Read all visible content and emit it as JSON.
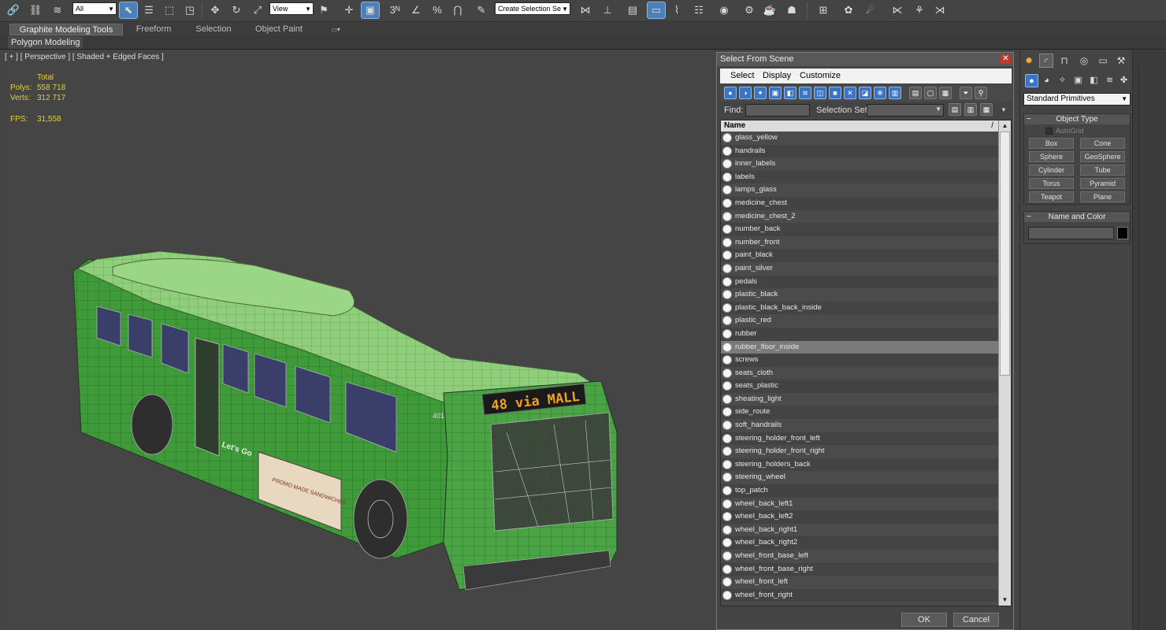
{
  "main_toolbar": {
    "selection_filter": "All",
    "reference_coord": "View",
    "named_selection_placeholder": "Create Selection Se",
    "snap_labels": [
      "3",
      "%"
    ]
  },
  "ribbon": {
    "tabs": [
      "Graphite Modeling Tools",
      "Freeform",
      "Selection",
      "Object Paint"
    ],
    "active_tab": 0,
    "panel_label": "Polygon Modeling"
  },
  "viewport": {
    "label": "[ + ] [ Perspective ] [ Shaded + Edged Faces ]",
    "stats_header": "Total",
    "stats": [
      {
        "key": "Polys:",
        "value": "558 718"
      },
      {
        "key": "Verts:",
        "value": "312 717"
      }
    ],
    "fps_key": "FPS:",
    "fps_value": "31,558",
    "bus": {
      "destination_sign": "48 via MALL",
      "unit_number": "401",
      "side_text": "Let's Go",
      "ad_text": "PROMO MADE SANDWICHES"
    }
  },
  "dialog": {
    "title": "Select From Scene",
    "menus": [
      "Select",
      "Display",
      "Customize"
    ],
    "find_label": "Find:",
    "find_value": "",
    "selection_set_label": "Selection Set:",
    "column_header": "Name",
    "items": [
      "glass_yellow",
      "handrails",
      "inner_labels",
      "labels",
      "lamps_glass",
      "medicine_chest",
      "medicine_chest_2",
      "number_back",
      "number_front",
      "paint_black",
      "paint_silver",
      "pedals",
      "plastic_black",
      "plastic_black_back_inside",
      "plastic_red",
      "rubber",
      "rubber_floor_inside",
      "screws",
      "seats_cloth",
      "seats_plastic",
      "sheating_light",
      "side_route",
      "soft_handrails",
      "steering_holder_front_left",
      "steering_holder_front_right",
      "steering_holders_back",
      "steering_wheel",
      "top_patch",
      "wheel_back_left1",
      "wheel_back_left2",
      "wheel_back_right1",
      "wheel_back_right2",
      "wheel_front_base_left",
      "wheel_front_base_right",
      "wheel_front_left",
      "wheel_front_right"
    ],
    "selected_item": "rubber_floor_inside",
    "ok_label": "OK",
    "cancel_label": "Cancel"
  },
  "command_panel": {
    "category": "Standard Primitives",
    "object_type_title": "Object Type",
    "autogrid_label": "AutoGrid",
    "autogrid_checked": false,
    "primitives": [
      "Box",
      "Cone",
      "Sphere",
      "GeoSphere",
      "Cylinder",
      "Tube",
      "Torus",
      "Pyramid",
      "Teapot",
      "Plane"
    ],
    "name_color_title": "Name and Color",
    "name_value": "",
    "color": "#000000"
  },
  "colors": {
    "accent": "#3a74c4",
    "stats_text": "#e2cf3b",
    "bus_green": "#3f9a3a",
    "bus_roof": "#8fce7a"
  }
}
